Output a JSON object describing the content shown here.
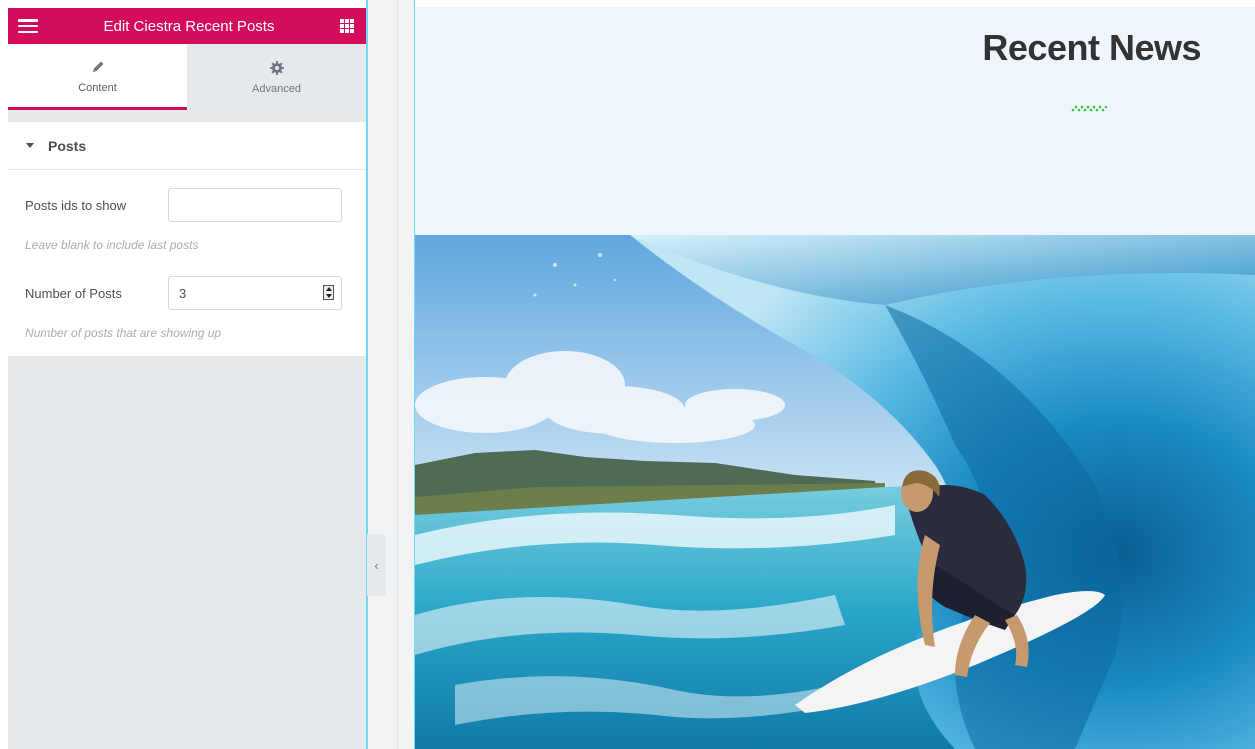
{
  "panel": {
    "title": "Edit Ciestra Recent Posts",
    "accent": "#d30c5c",
    "menu_icon": "hamburger-icon",
    "apps_icon": "grid-icon",
    "tabs": [
      {
        "label": "Content",
        "icon": "pencil-icon",
        "active": true
      },
      {
        "label": "Advanced",
        "icon": "gear-icon",
        "active": false
      }
    ],
    "section": {
      "title": "Posts",
      "controls": {
        "post_ids": {
          "label": "Posts ids to show",
          "value": "",
          "help": "Leave blank to include last posts"
        },
        "num_posts": {
          "label": "Number of Posts",
          "value": "3",
          "help": "Number of posts that are showing up"
        }
      }
    }
  },
  "collapse_handle": {
    "glyph": "‹",
    "icon": "chevron-left-icon"
  },
  "preview": {
    "heading": "Recent News",
    "ornament_color": "#2ecc40",
    "hero_image": "surfer-in-wave-photo"
  }
}
